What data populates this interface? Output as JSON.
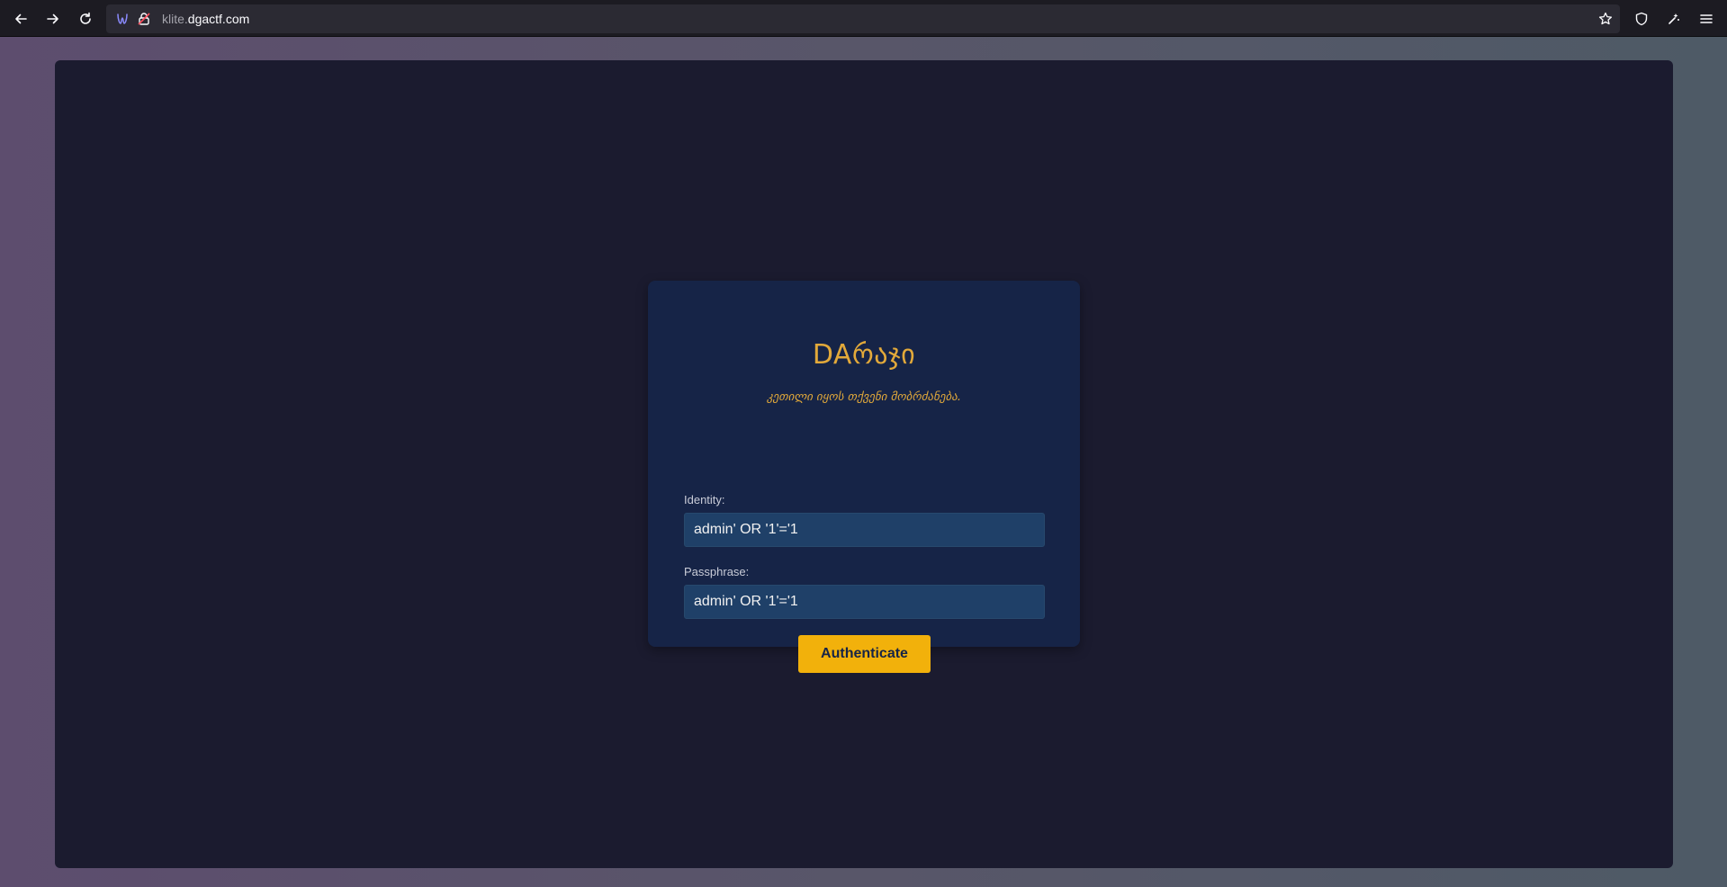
{
  "browser": {
    "url_subdomain": "klite.",
    "url_domain": "dgactf.com",
    "icons": {
      "back": "back-arrow-icon",
      "forward": "forward-arrow-icon",
      "reload": "reload-icon",
      "tracking": "tracking-protection-icon",
      "lock": "insecure-lock-icon",
      "bookmark": "bookmark-star-icon",
      "shield": "shield-icon",
      "extensions": "extensions-icon",
      "menu": "hamburger-menu-icon"
    }
  },
  "login": {
    "title": "DAრაჯი",
    "subtitle": "კეთილი იყოს თქვენი მობრძანება.",
    "identity_label": "Identity:",
    "identity_value": "admin' OR '1'='1",
    "passphrase_label": "Passphrase:",
    "passphrase_value": "admin' OR '1'='1",
    "submit_label": "Authenticate"
  },
  "colors": {
    "page_background": "#1b1b2f",
    "card_background": "#162447",
    "input_background": "#1f4068",
    "accent": "#e2a93a",
    "button": "#f2b10b",
    "button_text": "#162447"
  }
}
